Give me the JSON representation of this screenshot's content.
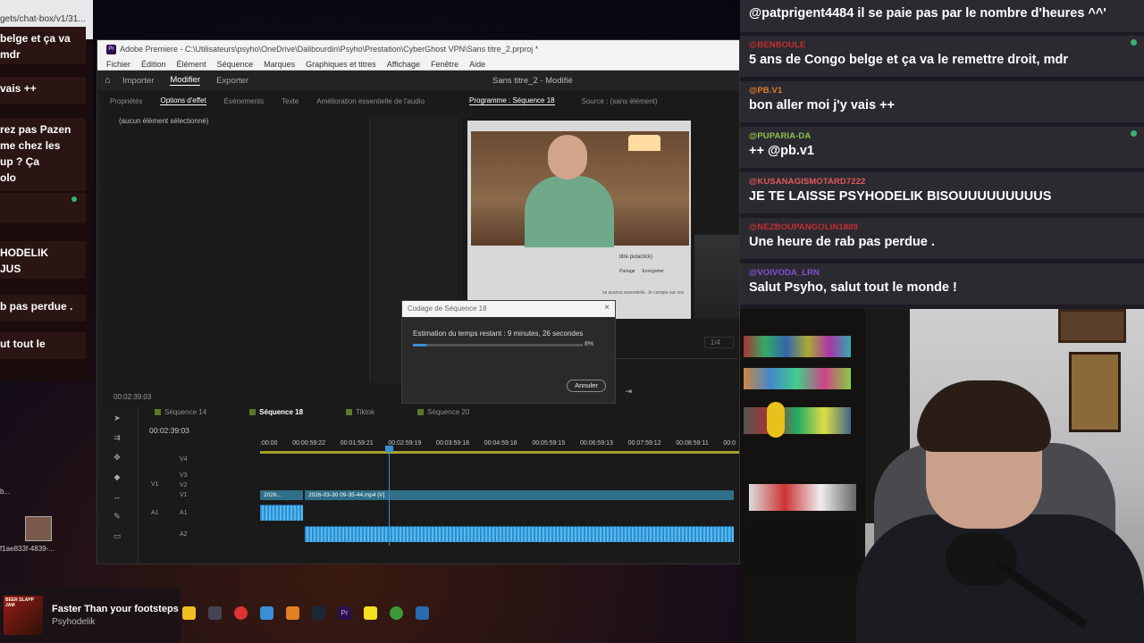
{
  "left_chat": {
    "url_fragment": "gets/chat-box/v1/31...",
    "messages": [
      {
        "text": "belge et ça va\nmdr"
      },
      {
        "text": "vais ++"
      },
      {
        "text": "rez pas Pazen\nme chez les\nup ? Ça\nolo"
      },
      {
        "text": "HODELIK\nJUS"
      },
      {
        "text": "b pas perdue ."
      },
      {
        "text": "ut tout le"
      }
    ]
  },
  "premiere": {
    "title": "Adobe Premiere - C:\\Utilisateurs\\psyho\\OneDrive\\Dalibourdin\\Psyho\\Prestation\\CyberGhost VPN\\Sans titre_2.prproj *",
    "menu": [
      "Fichier",
      "Édition",
      "Élément",
      "Séquence",
      "Marques",
      "Graphiques et titres",
      "Affichage",
      "Fenêtre",
      "Aide"
    ],
    "workspace": {
      "import": "Importer",
      "edit": "Modifier",
      "export": "Exporter",
      "project_title": "Sans titre_2 - Modifié"
    },
    "effect_tabs": [
      "Propriétés",
      "Options d'effet",
      "Événements",
      "Texte",
      "Amélioration essentielle de l'audio"
    ],
    "no_selection": "(aucun élément sélectionné)",
    "effect_timecode": "00:02:39:03",
    "program_tab": "Programme : Séquence 18",
    "source_tab": "Source : (sans élément)",
    "ratio": "1/4",
    "video_caption": "titre putaclick)",
    "video_buttons": [
      "Partage",
      "Enregistrer"
    ],
    "video_desc": "'se avance essentielle. Je compte sur vos",
    "timeline_tabs": [
      {
        "label": "Séquence 14",
        "color": "#5a7a2a"
      },
      {
        "label": "Séquence 18",
        "color": "#5a7a2a",
        "active": true
      },
      {
        "label": "Tiktok",
        "color": "#5a7a2a"
      },
      {
        "label": "Séquence 20",
        "color": "#5a7a2a"
      }
    ],
    "timeline_timecode": "00:02:39:03",
    "ruler": [
      ":00:00",
      "00:00:59:22",
      "00:01:59:21",
      "00:02:59:19",
      "00:03:59:18",
      "00:04:59:16",
      "00:05:59:15",
      "00:06:59:13",
      "00:07:59:12",
      "00:08:59:11",
      "00:0"
    ],
    "tracks": {
      "v4": "V4",
      "v3": "V3",
      "v2": "V2",
      "v1": "V1",
      "v1_src": "V1",
      "a1": "A1",
      "a1_src": "A1",
      "a2": "A2"
    },
    "clips": {
      "small": "2026...",
      "main": "2026-03-30 09-35-44.mp4 [V]"
    }
  },
  "encode_dialog": {
    "title": "Codage de Séquence 18",
    "estimate": "Estimation du temps restant : 9 minutes, 26 secondes",
    "progress_pct": 8,
    "progress_label": "8%",
    "cancel": "Annuler"
  },
  "now_playing": {
    "title": "Faster Than your footsteps",
    "artist": "Psyhodelik",
    "art_text": "BEER SLAPP JAM"
  },
  "file_label": "f1ae833f-4839-...",
  "left_dots": "b...",
  "chat": {
    "messages": [
      {
        "user": "",
        "user_color": "#ffffff",
        "text": "@patprigent4484 il se paie pas par le nombre d'heures ^^'",
        "badge": false
      },
      {
        "user": "@BENBOULE",
        "user_color": "#c23030",
        "text": "5 ans de Congo belge et ça va le remettre droit, mdr",
        "badge": true
      },
      {
        "user": "@PB.V1",
        "user_color": "#e07a2a",
        "text": "bon aller moi j'y vais ++",
        "badge": false
      },
      {
        "user": "@PUPARIA-DA",
        "user_color": "#8bc34a",
        "text": "++ @pb.v1",
        "badge": true
      },
      {
        "user": "@KUSANAGISMOTARD7222",
        "user_color": "#e05a5a",
        "text": "JE TE LAISSE PSYHODELIK BISOUUUUUUUUUS",
        "badge": false
      },
      {
        "user": "@NEZBOUPANGOLIN1889",
        "user_color": "#c23030",
        "text": "Une heure de rab pas perdue .",
        "badge": false
      },
      {
        "user": "@VOIVODA_LRN",
        "user_color": "#8a4fd8",
        "text": "Salut Psyho, salut tout le monde !",
        "badge": false
      }
    ]
  },
  "colors": {
    "accent_blue": "#3a8ed8",
    "chat_bg": "#2c2a31",
    "premiere_bg": "#1d1d1d"
  }
}
